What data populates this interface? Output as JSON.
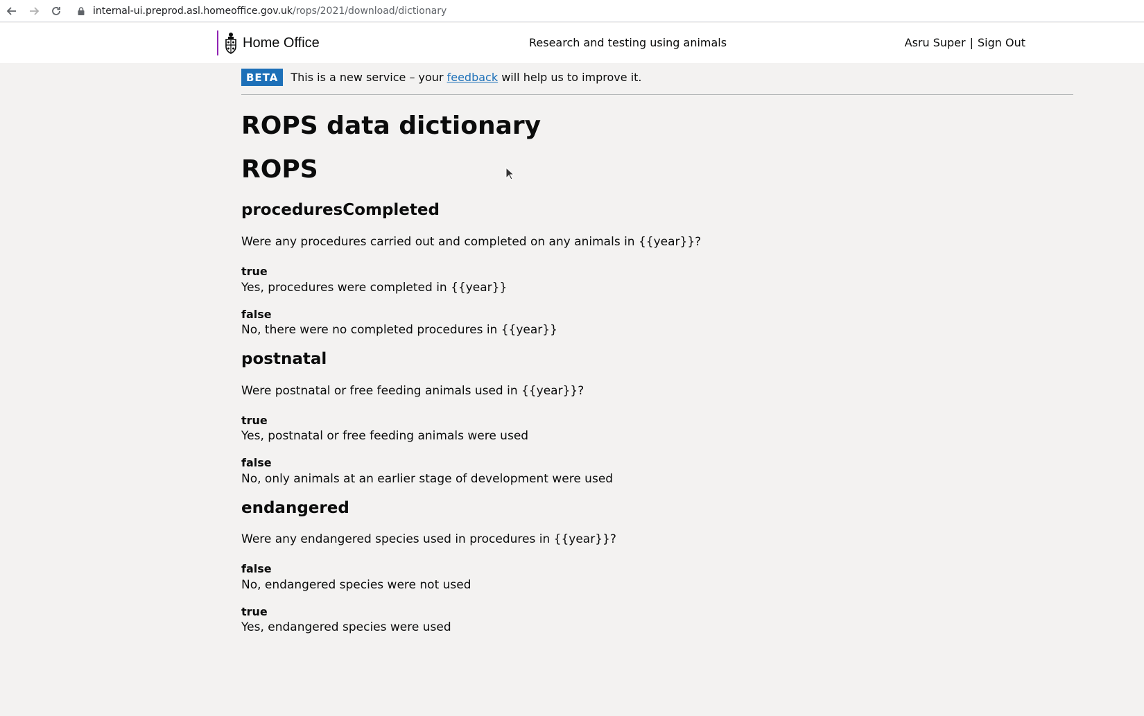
{
  "browser": {
    "url_host": "internal-ui.preprod.asl.homeoffice.gov.uk",
    "url_path": "/rops/2021/download/dictionary"
  },
  "header": {
    "logo_text": "Home Office",
    "service_name": "Research and testing using animals",
    "user_name": "Asru Super",
    "separator": "|",
    "sign_out": "Sign Out"
  },
  "banner": {
    "tag": "BETA",
    "text_before": "This is a new service – your ",
    "link": "feedback",
    "text_after": " will help us to improve it."
  },
  "page": {
    "title": "ROPS data dictionary",
    "section": "ROPS"
  },
  "fields": [
    {
      "name": "proceduresCompleted",
      "question": "Were any procedures carried out and completed on any animals in {{year}}?",
      "options": [
        {
          "key": "true",
          "label": "Yes, procedures were completed in {{year}}"
        },
        {
          "key": "false",
          "label": "No, there were no completed procedures in {{year}}"
        }
      ]
    },
    {
      "name": "postnatal",
      "question": "Were postnatal or free feeding animals used in {{year}}?",
      "options": [
        {
          "key": "true",
          "label": "Yes, postnatal or free feeding animals were used"
        },
        {
          "key": "false",
          "label": "No, only animals at an earlier stage of development were used"
        }
      ]
    },
    {
      "name": "endangered",
      "question": "Were any endangered species used in procedures in {{year}}?",
      "options": [
        {
          "key": "false",
          "label": "No, endangered species were not used"
        },
        {
          "key": "true",
          "label": "Yes, endangered species were used"
        }
      ]
    }
  ]
}
